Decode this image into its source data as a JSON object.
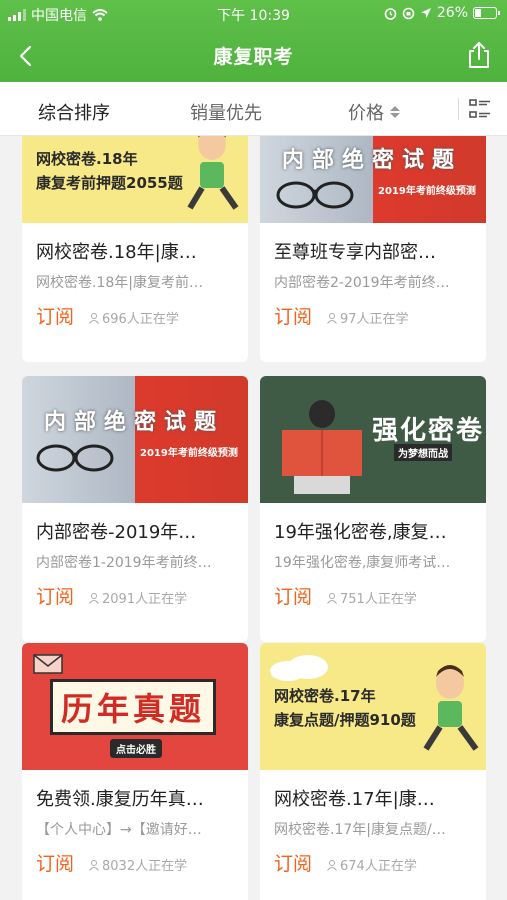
{
  "status_bar": {
    "carrier": "中国电信",
    "time": "下午 10:39",
    "battery": "26%"
  },
  "navbar": {
    "title": "康复职考"
  },
  "tabs": [
    {
      "label": "综合排序",
      "active": true
    },
    {
      "label": "销量优先",
      "active": false
    },
    {
      "label": "价格",
      "active": false
    }
  ],
  "courses": [
    {
      "title": "网校密卷.18年|康…",
      "subtitle": "网校密卷.18年|康复考前…",
      "button": "订阅",
      "learners": "696人正在学",
      "banner": {
        "line1": "网校密卷.18年",
        "line2": "康复考前押题2055题",
        "style": "yellow"
      }
    },
    {
      "title": "至尊班专享内部密…",
      "subtitle": "内部密卷2-2019年考前终…",
      "button": "订阅",
      "learners": "97人正在学",
      "banner": {
        "line1": "内部绝密试题",
        "line2": "2019年考前终级预测",
        "style": "red"
      }
    },
    {
      "title": "内部密卷-2019年…",
      "subtitle": "内部密卷1-2019年考前终…",
      "button": "订阅",
      "learners": "2091人正在学",
      "banner": {
        "line1": "内部绝密试题",
        "line2": "2019年考前终级预测",
        "style": "red"
      }
    },
    {
      "title": "19年强化密卷,康复…",
      "subtitle": "19年强化密卷,康复师考试…",
      "button": "订阅",
      "learners": "751人正在学",
      "banner": {
        "line1": "强化密卷",
        "line2": "为梦想而战",
        "style": "dark"
      }
    },
    {
      "title": "免费领.康复历年真…",
      "subtitle": "【个人中心】→【邀请好…",
      "button": "订阅",
      "learners": "8032人正在学",
      "banner": {
        "line1": "历年真题",
        "line2": "点击必胜",
        "style": "coral"
      }
    },
    {
      "title": "网校密卷.17年|康…",
      "subtitle": "网校密卷.17年|康复点题/…",
      "button": "订阅",
      "learners": "674人正在学",
      "banner": {
        "line1": "网校密卷.17年",
        "line2": "康复点题/押题910题",
        "style": "yellow"
      }
    }
  ],
  "colors": {
    "header_green": "#4eb23c",
    "accent_orange": "#f0641e",
    "banner_red": "#dd3a2d",
    "banner_yellow": "#f7e888"
  }
}
